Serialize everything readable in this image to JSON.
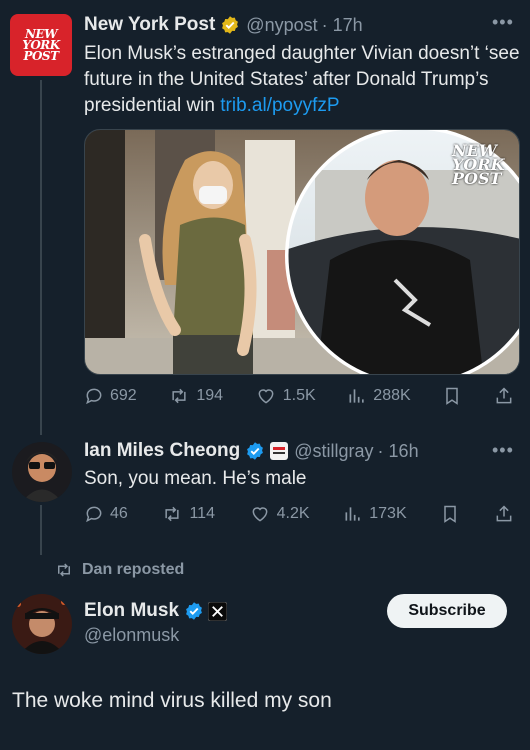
{
  "tweet1": {
    "display_name": "New York Post",
    "handle": "@nypost",
    "time": "· 17h",
    "logo_lines": [
      "NEW",
      "YORK",
      "POST"
    ],
    "text": "Elon Musk’s estranged daughter Vivian doesn’t ‘see future in the United States’ after Donald Trump’s presidential win ",
    "link": "trib.al/poyyfzP",
    "media_watermark_lines": [
      "NEW",
      "YORK",
      "POST"
    ],
    "stats": {
      "replies": "692",
      "reposts": "194",
      "likes": "1.5K",
      "views": "288K"
    }
  },
  "tweet2": {
    "display_name": "Ian Miles Cheong",
    "handle": "@stillgray",
    "time": "· 16h",
    "text": "Son, you mean. He’s male",
    "stats": {
      "replies": "46",
      "reposts": "114",
      "likes": "4.2K",
      "views": "173K"
    }
  },
  "repost_label": "Dan reposted",
  "tweet3": {
    "display_name": "Elon Musk",
    "handle": "@elonmusk",
    "subscribe_label": "Subscribe",
    "text": "The woke mind virus killed my son"
  },
  "colors": {
    "background": "#15202b",
    "text": "#e7e9ea",
    "muted": "#8b98a5",
    "link": "#1d9bf0",
    "verified_blue": "#1d9bf0",
    "verified_gold": "#e2b719",
    "nyp_red": "#d8232a"
  },
  "icons": [
    "reply-icon",
    "repost-icon",
    "like-icon",
    "views-icon",
    "bookmark-icon",
    "share-icon",
    "verified-gold-icon",
    "verified-blue-icon",
    "x-affiliate-icon",
    "more-icon"
  ]
}
